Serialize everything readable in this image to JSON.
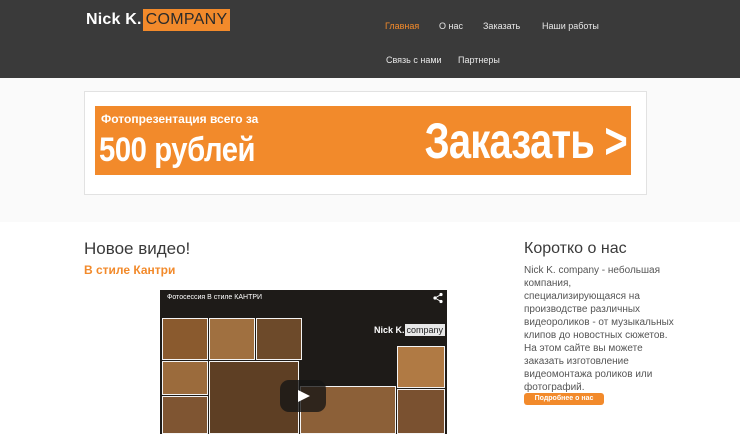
{
  "header": {
    "logo_name": "Nick K.",
    "logo_company": "COMPANY",
    "nav": [
      {
        "label": "Главная",
        "active": true
      },
      {
        "label": "О нас",
        "active": false
      },
      {
        "label": "Заказать",
        "active": false
      },
      {
        "label": "Наши работы",
        "active": false
      },
      {
        "label": "Связь с нами",
        "active": false
      },
      {
        "label": "Партнеры",
        "active": false
      }
    ]
  },
  "banner": {
    "subtitle": "Фотопрезентация всего за",
    "price": "500 рублей",
    "cta": "Заказать >"
  },
  "video_section": {
    "heading": "Новое видео!",
    "subheading": "В стиле Кантри",
    "video_title": "Фотосессия В стиле КАНТРИ",
    "video_logo_name": "Nick K.",
    "video_logo_company": "company"
  },
  "about": {
    "heading": "Коротко о нас",
    "text": "Nick K. company - небольшая компания, специализирующаяся на производстве различных видеороликов - от музыкальных клипов до новостных сюжетов. На этом сайте вы можете заказать изготовление видеомонтажа роликов или фотографий.",
    "button_label": "Подробнее о нас"
  },
  "colors": {
    "accent": "#f28a2b",
    "header_bg": "#3a3a3a",
    "video_bg": "#1e1b18"
  },
  "icons": {
    "share": "share-icon",
    "play": "play-icon"
  }
}
